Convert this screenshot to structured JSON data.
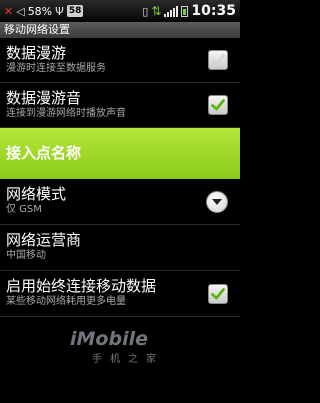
{
  "statusbar": {
    "battery_percent": "58%",
    "badge": "58",
    "time": "10:35",
    "signal_level": 4
  },
  "titlebar": {
    "title": "移动网络设置"
  },
  "items": [
    {
      "title": "数据漫游",
      "summary": "漫游时连接至数据服务",
      "checked": false
    },
    {
      "title": "数据漫游音",
      "summary": "连接到漫游网络时播放声音",
      "checked": true
    },
    {
      "title": "接入点名称",
      "highlighted": true
    },
    {
      "title": "网络模式",
      "summary": "仅 GSM"
    },
    {
      "title": "网络运营商",
      "summary": "中国移动"
    },
    {
      "title": "启用始终连接移动数据",
      "summary": "某些移动网络耗用更多电量",
      "checked": true
    }
  ],
  "watermark": {
    "logo": "iMobile",
    "subtitle": "手机之家"
  }
}
